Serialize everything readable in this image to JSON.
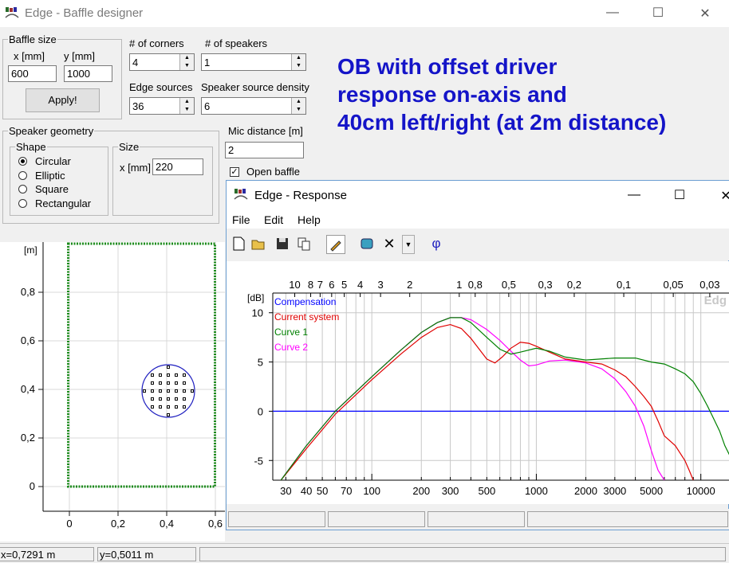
{
  "main_window": {
    "title": "Edge - Baffle designer",
    "controls": {
      "minimize": "—",
      "maximize": "☐",
      "close": "✕"
    }
  },
  "baffle_size": {
    "legend": "Baffle size",
    "x_label": "x [mm]",
    "y_label": "y [mm]",
    "x_value": "600",
    "y_value": "1000",
    "apply_label": "Apply!"
  },
  "corners": {
    "label": "# of corners",
    "value": "4"
  },
  "speakers": {
    "label": "# of speakers",
    "value": "1"
  },
  "edge_sources": {
    "label": "Edge sources",
    "value": "36"
  },
  "source_density": {
    "label": "Speaker source density",
    "value": "6"
  },
  "headline": {
    "line1": "OB with offset driver",
    "line2": "response on-axis and",
    "line3": "40cm left/right (at 2m distance)"
  },
  "speaker_geometry": {
    "legend": "Speaker geometry",
    "shape_legend": "Shape",
    "shapes": [
      {
        "label": "Circular",
        "selected": true
      },
      {
        "label": "Elliptic",
        "selected": false
      },
      {
        "label": "Square",
        "selected": false
      },
      {
        "label": "Rectangular",
        "selected": false
      }
    ],
    "size_legend": "Size",
    "size_label": "x [mm]",
    "size_value": "220"
  },
  "mic": {
    "label": "Mic distance [m]",
    "value": "2",
    "open_baffle_label": "Open baffle",
    "open_baffle_checked": true
  },
  "baffle_plot": {
    "y_unit": "[m]",
    "y_ticks": [
      "0,8",
      "0,6",
      "0,4",
      "0,2",
      "0"
    ],
    "x_ticks": [
      "0",
      "0,2",
      "0,4",
      "0,6"
    ]
  },
  "status": {
    "x": "x=0,7291 m",
    "y": "y=0,5011 m"
  },
  "response_window": {
    "title": "Edge - Response",
    "controls": {
      "minimize": "—",
      "maximize": "☐",
      "close": "✕"
    },
    "menu": {
      "file": "File",
      "edit": "Edit",
      "help": "Help"
    },
    "toolbar": {
      "phase": "φ"
    }
  },
  "chart_data": {
    "type": "line",
    "title": "",
    "ylabel": "[dB]",
    "xlabel": "",
    "x_scale": "log",
    "xlim": [
      25,
      15000
    ],
    "ylim": [
      -7,
      12
    ],
    "y_ticks": [
      10,
      5,
      0,
      -5
    ],
    "y_tick_labels": [
      "10",
      "5",
      "0",
      "-5"
    ],
    "x_ticks": [
      30,
      40,
      50,
      70,
      100,
      200,
      300,
      500,
      1000,
      2000,
      3000,
      5000,
      10000
    ],
    "x_tick_labels": [
      "30",
      "40",
      "50",
      "70",
      "100",
      "200",
      "300",
      "500",
      "1000",
      "2000",
      "3000",
      "5000",
      "10000"
    ],
    "top_axis_ticks": [
      {
        "label": "10",
        "f": 34
      },
      {
        "label": "8",
        "f": 42.5
      },
      {
        "label": "7",
        "f": 48.5
      },
      {
        "label": "6",
        "f": 57
      },
      {
        "label": "5",
        "f": 68
      },
      {
        "label": "4",
        "f": 85
      },
      {
        "label": "3",
        "f": 113
      },
      {
        "label": "2",
        "f": 170
      },
      {
        "label": "1",
        "f": 340
      },
      {
        "label": "0,8",
        "f": 425
      },
      {
        "label": "0,5",
        "f": 680
      },
      {
        "label": "0,3",
        "f": 1133
      },
      {
        "label": "0,2",
        "f": 1700
      },
      {
        "label": "0,1",
        "f": 3400
      },
      {
        "label": "0,05",
        "f": 6800
      },
      {
        "label": "0,03",
        "f": 11333
      }
    ],
    "watermark": "Edg",
    "grid": true,
    "legend_position": "top-left",
    "series": [
      {
        "name": "Compensation",
        "color": "#0000ff",
        "x": [
          25,
          15000
        ],
        "y": [
          0,
          0
        ]
      },
      {
        "name": "Current system",
        "color": "#e00000",
        "x": [
          28,
          40,
          60,
          100,
          150,
          200,
          250,
          300,
          350,
          400,
          500,
          560,
          620,
          700,
          800,
          900,
          1000,
          1200,
          1500,
          2000,
          2500,
          3000,
          3500,
          4000,
          4500,
          5000,
          5500,
          6000,
          7000,
          8000,
          8500,
          9000
        ],
        "y": [
          -7,
          -3.8,
          -0.3,
          3.2,
          5.8,
          7.5,
          8.5,
          8.8,
          8.4,
          7.4,
          5.3,
          4.9,
          5.5,
          6.4,
          7,
          6.9,
          6.6,
          6,
          5.3,
          5,
          4.8,
          4.2,
          3.5,
          2.5,
          1.5,
          0.5,
          -1,
          -2.5,
          -3.5,
          -5,
          -6,
          -7
        ]
      },
      {
        "name": "Curve 1",
        "color": "#008000",
        "x": [
          28,
          40,
          60,
          100,
          150,
          200,
          250,
          300,
          350,
          400,
          500,
          600,
          700,
          800,
          1000,
          1200,
          1500,
          2000,
          3000,
          4000,
          5000,
          6000,
          7000,
          8000,
          9000,
          10000,
          11000,
          12000,
          13000,
          14000,
          15000
        ],
        "y": [
          -7,
          -3.5,
          0,
          3.5,
          6.2,
          8,
          9,
          9.5,
          9.5,
          9,
          7.5,
          6.3,
          5.8,
          6,
          6.4,
          6.1,
          5.5,
          5.2,
          5.4,
          5.4,
          5,
          4.8,
          4.3,
          3.8,
          3,
          1.8,
          0.5,
          -0.8,
          -2,
          -3.5,
          -4.5
        ]
      },
      {
        "name": "Curve 2",
        "color": "#ff00ff",
        "x": [
          28,
          40,
          60,
          100,
          150,
          200,
          250,
          300,
          350,
          400,
          500,
          600,
          700,
          800,
          900,
          1000,
          1200,
          1500,
          2000,
          2500,
          3000,
          3500,
          4000,
          4500,
          5000,
          5500,
          6000
        ],
        "y": [
          -7,
          -3.5,
          0,
          3.5,
          6.2,
          8,
          9,
          9.5,
          9.5,
          9.3,
          8.3,
          7.2,
          6.1,
          5.2,
          4.6,
          4.7,
          5.1,
          5.2,
          4.9,
          4.3,
          3.3,
          2,
          0.5,
          -1.5,
          -4,
          -6,
          -7
        ]
      }
    ]
  }
}
